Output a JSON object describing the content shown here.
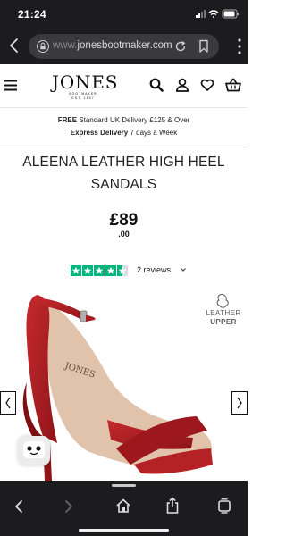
{
  "status_bar": {
    "time": "21:24"
  },
  "browser": {
    "url_prefix": "www.",
    "url_domain": "jonesbootmaker.com"
  },
  "site_header": {
    "logo": "JONES",
    "logo_tagline": "BOOTMAKER",
    "logo_est": "EST. 1857"
  },
  "delivery_banner": {
    "line1_bold": "FREE",
    "line1_rest": " Standard UK Delivery £125 & Over",
    "line2_bold": "Express Delivery",
    "line2_rest": " 7 days a Week"
  },
  "product": {
    "title": "ALEENA LEATHER HIGH HEEL SANDALS",
    "price_main": "£89",
    "price_pence": ".00",
    "rating": 4.5,
    "rating_max": 5,
    "reviews_text": "2 reviews",
    "badge_line1": "LEATHER",
    "badge_line2": "UPPER",
    "insole_brand": "JONES"
  },
  "colors": {
    "browser_chrome": "#1c1c1e",
    "trustpilot_green": "#00b67a",
    "sandal_red": "#a81b20"
  },
  "icons": {
    "status": [
      "signal-icon",
      "wifi-icon",
      "battery-icon"
    ],
    "browser": [
      "back-icon",
      "lock-icon",
      "reload-icon",
      "bookmark-icon",
      "more-menu-icon"
    ],
    "header": [
      "hamburger-icon",
      "search-icon",
      "account-icon",
      "heart-icon",
      "basket-icon"
    ],
    "toolbar": [
      "back-icon",
      "forward-icon",
      "home-icon",
      "share-icon",
      "tabs-icon"
    ]
  }
}
